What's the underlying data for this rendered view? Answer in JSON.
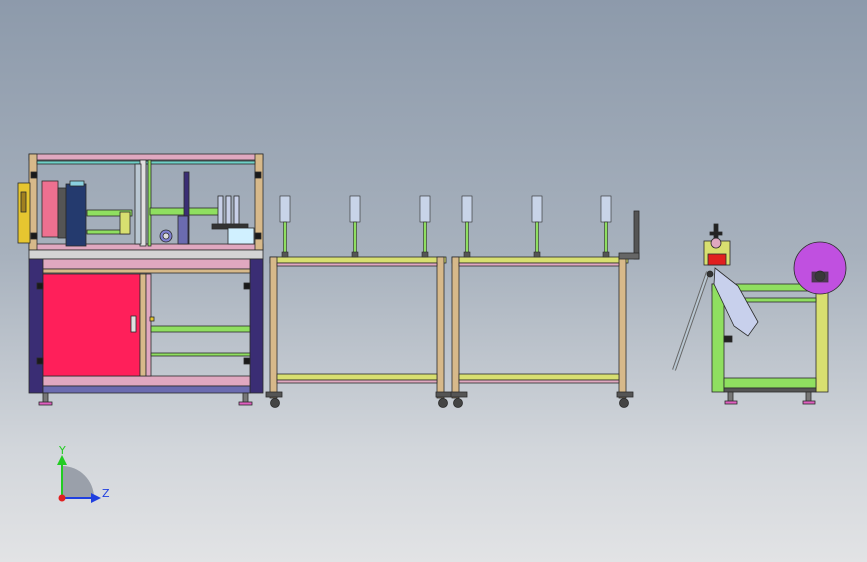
{
  "axis_triad": {
    "y_label": "Y",
    "z_label": "Z",
    "colors": {
      "y": "#22cc22",
      "z": "#1f3fe0",
      "x": "#e02020"
    }
  },
  "palette": {
    "frame_pink": "#e0a8c0",
    "frame_tan": "#d7b98a",
    "frame_yellow": "#d8df70",
    "frame_green": "#8fdf60",
    "door_red": "#ff1f5a",
    "cabinet_navy": "#3a2d74",
    "roll_purple": "#c050e0",
    "accent_blue": "#2a4a80"
  }
}
